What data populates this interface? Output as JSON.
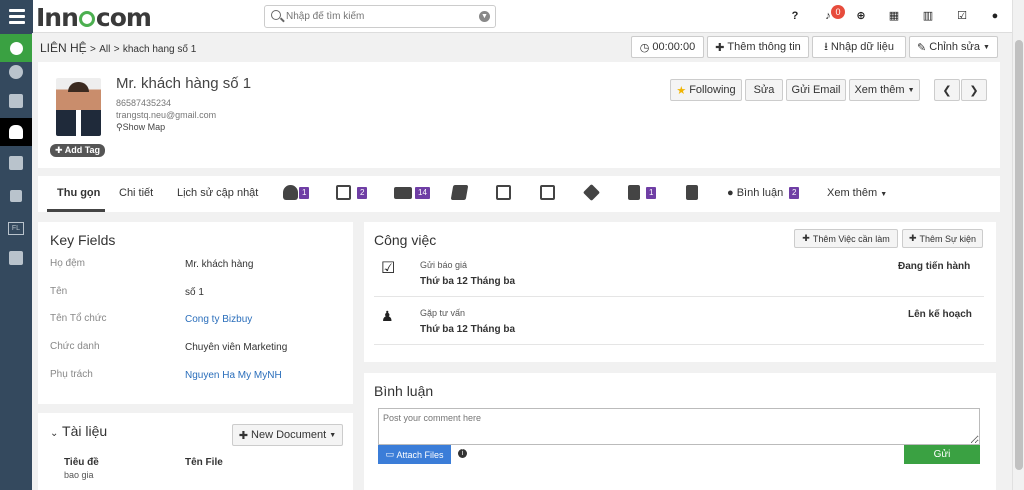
{
  "app": {
    "logo": "Innocom",
    "logo_pre": "Inn",
    "logo_post": "com"
  },
  "search": {
    "placeholder": "Nhập để tìm kiếm"
  },
  "notifications": {
    "count": "0"
  },
  "breadcrumb": {
    "module": "LIÊN HỆ",
    "sep1": ">",
    "all": "All",
    "sep2": ">",
    "current": "khach hang số 1"
  },
  "header_actions": {
    "timer": "00:00:00",
    "add_info": "Thêm thông tin",
    "import": "Nhập dữ liệu",
    "edit": "Chỉnh sửa"
  },
  "contact": {
    "name": "Mr. khách hàng số 1",
    "phone": "86587435234",
    "email": "trangstq.neu@gmail.com",
    "show_map": "Show Map",
    "add_tag": "Add Tag"
  },
  "record_actions": {
    "following": "Following",
    "edit": "Sửa",
    "email": "Gửi Email",
    "more": "Xem thêm"
  },
  "tabs": {
    "summary": "Thu gọn",
    "details": "Chi tiết",
    "history": "Lịch sử cập nhật",
    "badge_deals": "1",
    "badge_calendar": "2",
    "badge_email": "14",
    "badge_docs": "1",
    "comments": "Bình luận",
    "badge_comments": "2",
    "more": "Xem thêm"
  },
  "key_fields": {
    "title": "Key Fields",
    "rows": [
      {
        "label": "Họ đệm",
        "value": "Mr. khách hàng"
      },
      {
        "label": "Tên",
        "value": "số 1"
      },
      {
        "label": "Tên Tổ chức",
        "value": "Cong ty Bizbuy"
      },
      {
        "label": "Chức danh",
        "value": "Chuyên viên Marketing"
      },
      {
        "label": "Phụ trách",
        "value": "Nguyen Ha My MyNH"
      }
    ]
  },
  "tasks": {
    "title": "Công việc",
    "add_task": "Thêm Việc cần làm",
    "add_event": "Thêm Sự kiện",
    "items": [
      {
        "title": "Gửi báo giá",
        "date": "Thứ ba 12 Tháng ba",
        "status": "Đang tiến hành"
      },
      {
        "title": "Gặp tư vấn",
        "date": "Thứ ba 12 Tháng ba",
        "status": "Lên kế hoạch"
      }
    ]
  },
  "documents": {
    "title": "Tài liệu",
    "new_doc": "New Document",
    "col_title": "Tiêu đề",
    "col_file": "Tên File",
    "row1_title": "bao gia"
  },
  "comments": {
    "title": "Bình luận",
    "placeholder": "Post your comment here",
    "attach": "Attach Files",
    "send": "Gửi"
  },
  "colors": {
    "sidebar": "#34495e",
    "accent_green": "#3aa142",
    "badge_purple": "#6f3ea5",
    "link_blue": "#2a6ebb"
  }
}
